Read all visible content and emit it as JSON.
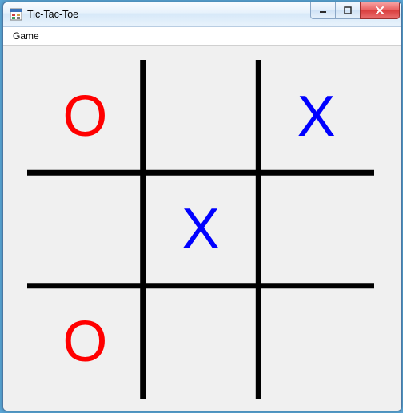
{
  "window": {
    "title": "Tic-Tac-Toe"
  },
  "menubar": {
    "items": [
      {
        "label": "Game"
      }
    ]
  },
  "colors": {
    "x": "#0000ff",
    "o": "#ff0000"
  },
  "board": {
    "cells": [
      [
        "O",
        "",
        "X"
      ],
      [
        "",
        "X",
        ""
      ],
      [
        "O",
        "",
        ""
      ]
    ]
  }
}
